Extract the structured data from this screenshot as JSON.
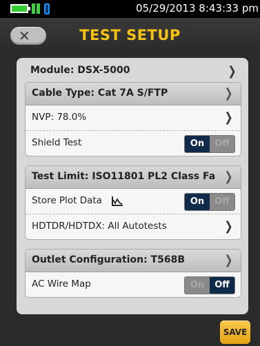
{
  "status": {
    "datetime": "05/29/2013 8:43:33 pm"
  },
  "header": {
    "title": "TEST SETUP",
    "back_icon": "x-back-icon"
  },
  "module": {
    "label": "Module: DSX-5000"
  },
  "cable": {
    "label": "Cable Type: Cat 7A S/FTP",
    "nvp_label": "NVP: 78.0%",
    "shield_label": "Shield Test",
    "shield_on": "On",
    "shield_off": "Off",
    "shield_state": "on"
  },
  "limit": {
    "label": "Test Limit: ISO11801 PL2 Class Fa",
    "plot_label": "Store Plot Data",
    "plot_on": "On",
    "plot_off": "Off",
    "plot_state": "on",
    "hdtdr_label": "HDTDR/HDTDX: All Autotests"
  },
  "outlet": {
    "label": "Outlet Configuration: T568B",
    "acwire_label": "AC Wire Map",
    "acwire_on": "On",
    "acwire_off": "Off",
    "acwire_state": "off"
  },
  "footer": {
    "save_label": "SAVE"
  },
  "colors": {
    "accent": "#f5c211",
    "toggle_active": "#102a4a",
    "battery": "#33cc33"
  }
}
